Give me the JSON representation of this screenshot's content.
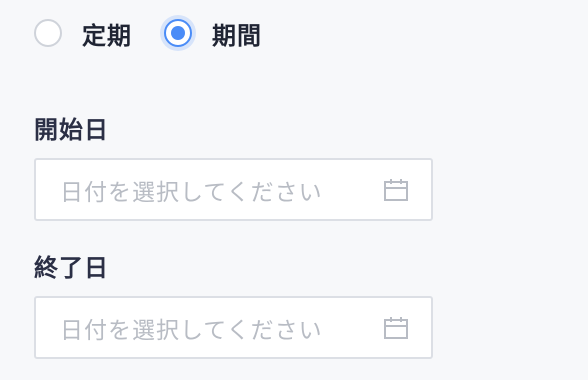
{
  "period_type": {
    "options": [
      {
        "label": "定期",
        "selected": false
      },
      {
        "label": "期間",
        "selected": true
      }
    ]
  },
  "start_date": {
    "label": "開始日",
    "placeholder": "日付を選択してください",
    "icon": "calendar-icon"
  },
  "end_date": {
    "label": "終了日",
    "placeholder": "日付を選択してください",
    "icon": "calendar-icon"
  },
  "colors": {
    "accent": "#4a8cf7",
    "background": "#f7f8fa",
    "label_text": "#2b2f45",
    "placeholder_text": "#b8bcc4",
    "input_border": "#dcdfe5"
  }
}
